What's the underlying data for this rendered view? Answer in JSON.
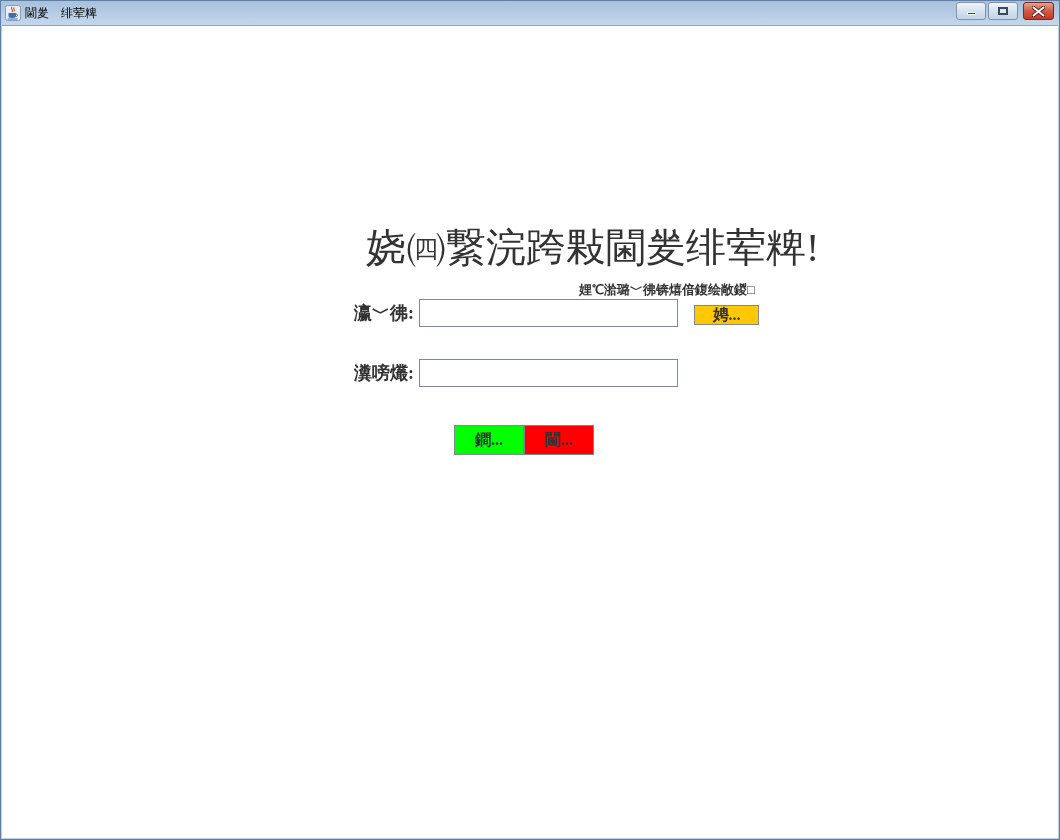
{
  "window": {
    "title": "閫夎　绯荤粺"
  },
  "heading": "娆㈣繋浣跨敤閫夎绯荤粺!",
  "form": {
    "hint": "娌℃湁璐﹀彿锛熺偣鍑绘敞鍐□",
    "fields": [
      {
        "label": "瀛﹀彿:"
      },
      {
        "label": "瀵嗙爜:"
      }
    ],
    "register_button": {
      "label": "娉..."
    }
  },
  "actions": [
    {
      "label": "鐧...",
      "color": "#00ff00"
    },
    {
      "label": "閫...",
      "color": "#ff0000"
    }
  ]
}
